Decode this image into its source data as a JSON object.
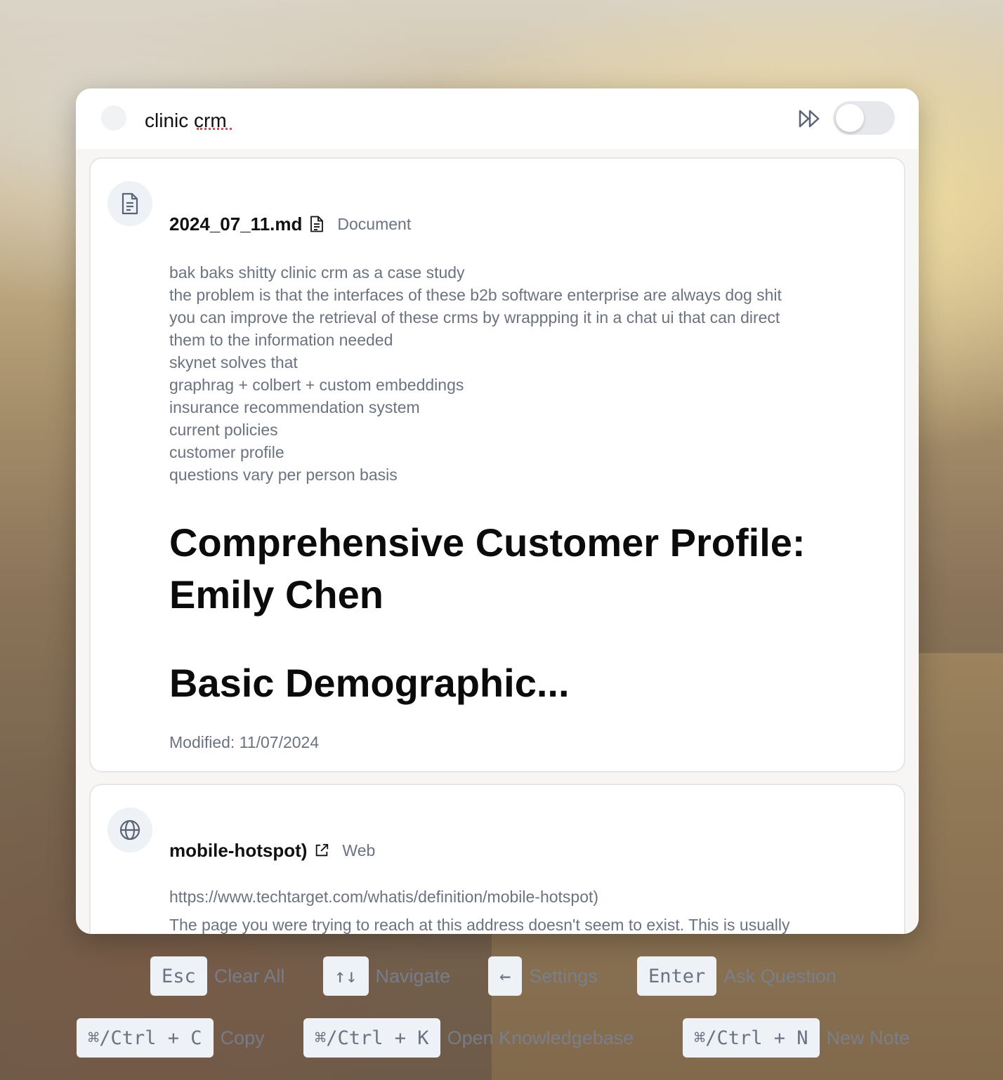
{
  "search": {
    "query": "clinic crm"
  },
  "toggle": {
    "on": false
  },
  "results": [
    {
      "icon": "document-icon",
      "title": "2024_07_11.md",
      "type": "Document",
      "lines": [
        "bak baks shitty clinic crm as a case study",
        "the problem is that the interfaces of these b2b software enterprise are always dog shit",
        "you can improve the retrieval of these crms by wrappping it in a chat ui that can direct",
        "them to the information needed",
        "skynet solves that",
        "graphrag + colbert + custom embeddings",
        "insurance recommendation system",
        "current policies",
        "customer profile",
        "questions vary per person basis"
      ],
      "heading1": "Comprehensive Customer Profile: Emily Chen",
      "heading2": "Basic Demographic...",
      "modified": "Modified: 11/07/2024"
    },
    {
      "icon": "globe-icon",
      "title": "mobile-hotspot)",
      "type": "Web",
      "url": "https://www.techtarget.com/whatis/definition/mobile-hotspot)",
      "desc": "The page you were trying to reach at this address doesn't seem to exist. This is usually"
    }
  ],
  "shortcuts": {
    "row1": [
      {
        "key": "Esc",
        "label": "Clear All"
      },
      {
        "key": "↑↓",
        "label": "Navigate"
      },
      {
        "key": "←",
        "label": "Settings"
      },
      {
        "key": "Enter",
        "label": "Ask Question"
      }
    ],
    "row2": [
      {
        "key": "⌘/Ctrl + C",
        "label": "Copy"
      },
      {
        "key": "⌘/Ctrl + K",
        "label": "Open Knowledgebase"
      },
      {
        "key": "⌘/Ctrl + N",
        "label": "New Note"
      }
    ]
  }
}
